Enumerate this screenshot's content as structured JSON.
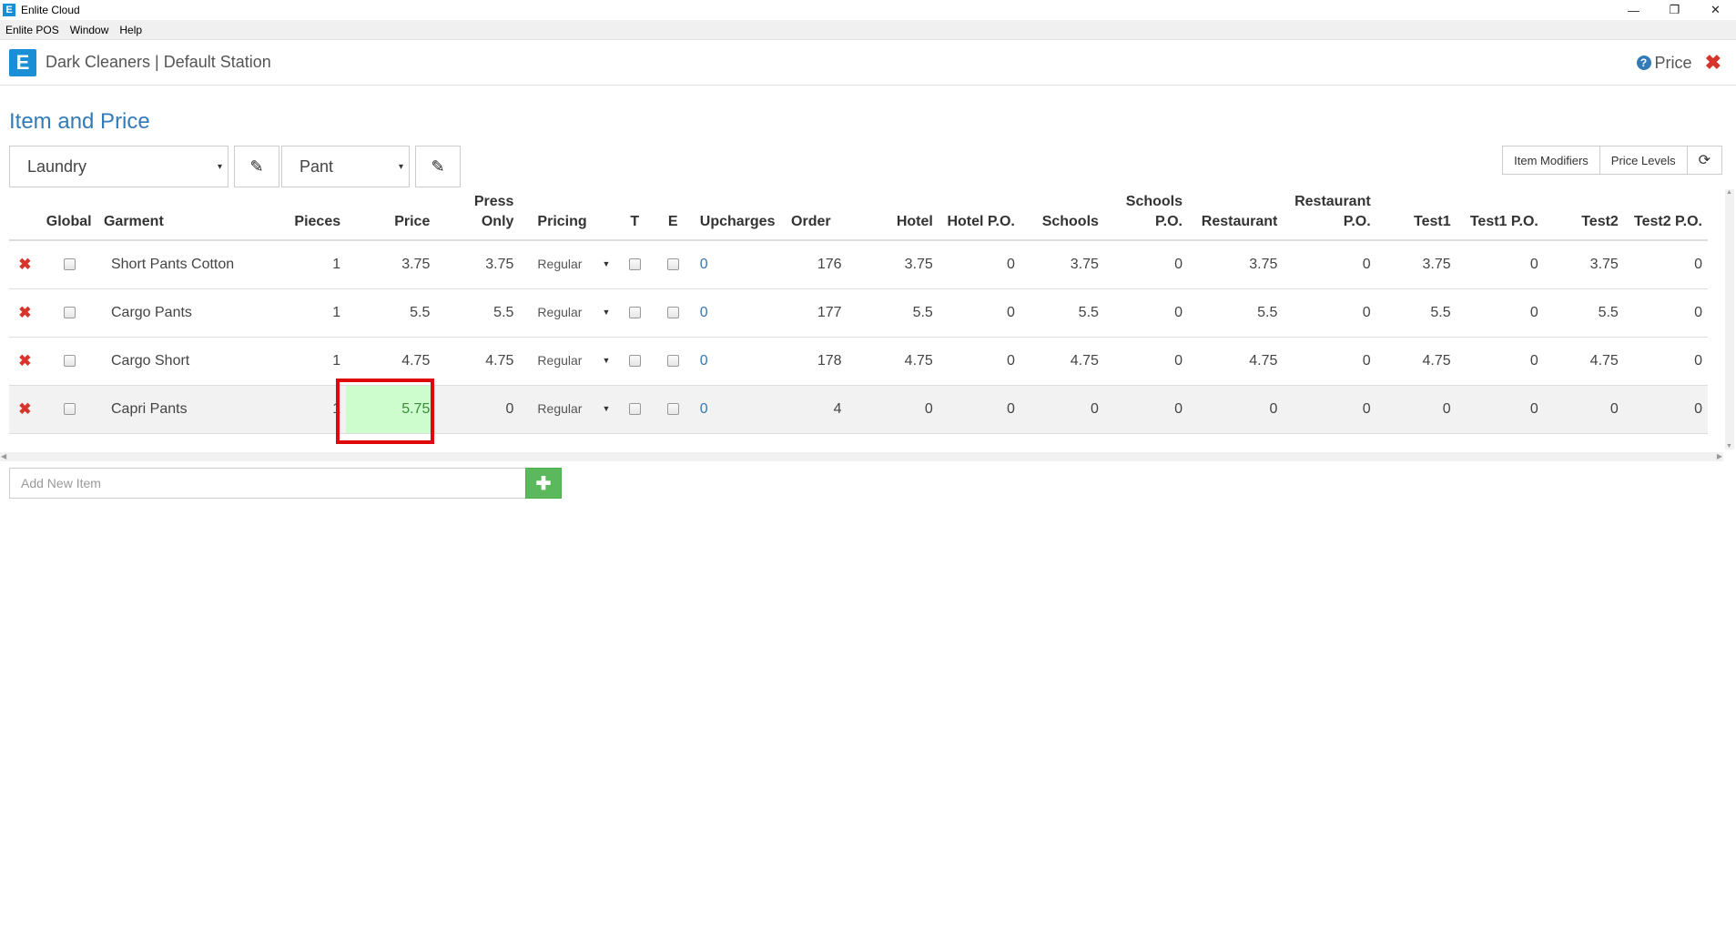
{
  "window": {
    "app_icon": "E",
    "title": "Enlite Cloud",
    "controls": {
      "minimize": "—",
      "restore": "❐",
      "close": "✕"
    }
  },
  "menu": {
    "items": [
      "Enlite POS",
      "Window",
      "Help"
    ]
  },
  "header": {
    "logo": "E",
    "title": "Dark Cleaners | Default Station",
    "help_icon": "?",
    "help_label": "Price",
    "close_icon": "✖"
  },
  "page": {
    "title": "Item and Price"
  },
  "toolbar": {
    "department": "Laundry",
    "category": "Pant",
    "caret": "▾",
    "edit_icon": "✎",
    "item_modifiers": "Item Modifiers",
    "price_levels": "Price Levels",
    "refresh_icon": "⟳"
  },
  "table": {
    "headers": {
      "global": "Global",
      "garment": "Garment",
      "pieces": "Pieces",
      "price": "Price",
      "press_only_1": "Press",
      "press_only_2": "Only",
      "pricing": "Pricing",
      "t": "T",
      "e": "E",
      "upcharges": "Upcharges",
      "order": "Order",
      "hotel": "Hotel",
      "hotel_po": "Hotel P.O.",
      "schools": "Schools",
      "schools_po_1": "Schools",
      "schools_po_2": "P.O.",
      "restaurant": "Restaurant",
      "restaurant_po_1": "Restaurant",
      "restaurant_po_2": "P.O.",
      "test1": "Test1",
      "test1_po": "Test1 P.O.",
      "test2": "Test2",
      "test2_po": "Test2 P.O."
    },
    "delete_icon": "✖",
    "pricing_caret": "▼",
    "rows": [
      {
        "garment": "Short Pants Cotton",
        "pieces": "1",
        "price": "3.75",
        "press_only": "3.75",
        "pricing": "Regular",
        "upcharges": "0",
        "order": "176",
        "hotel": "3.75",
        "hotel_po": "0",
        "schools": "3.75",
        "schools_po": "0",
        "restaurant": "3.75",
        "restaurant_po": "0",
        "test1": "3.75",
        "test1_po": "0",
        "test2": "3.75",
        "test2_po": "0"
      },
      {
        "garment": "Cargo Pants",
        "pieces": "1",
        "price": "5.5",
        "press_only": "5.5",
        "pricing": "Regular",
        "upcharges": "0",
        "order": "177",
        "hotel": "5.5",
        "hotel_po": "0",
        "schools": "5.5",
        "schools_po": "0",
        "restaurant": "5.5",
        "restaurant_po": "0",
        "test1": "5.5",
        "test1_po": "0",
        "test2": "5.5",
        "test2_po": "0"
      },
      {
        "garment": "Cargo Short",
        "pieces": "1",
        "price": "4.75",
        "press_only": "4.75",
        "pricing": "Regular",
        "upcharges": "0",
        "order": "178",
        "hotel": "4.75",
        "hotel_po": "0",
        "schools": "4.75",
        "schools_po": "0",
        "restaurant": "4.75",
        "restaurant_po": "0",
        "test1": "4.75",
        "test1_po": "0",
        "test2": "4.75",
        "test2_po": "0"
      },
      {
        "garment": "Capri Pants",
        "pieces": "1",
        "price": "5.75",
        "press_only": "0",
        "pricing": "Regular",
        "upcharges": "0",
        "order": "4",
        "hotel": "0",
        "hotel_po": "0",
        "schools": "0",
        "schools_po": "0",
        "restaurant": "0",
        "restaurant_po": "0",
        "test1": "0",
        "test1_po": "0",
        "test2": "0",
        "test2_po": "0"
      }
    ]
  },
  "scroll": {
    "up": "▲",
    "down": "▼",
    "left": "◀",
    "right": "▶"
  },
  "add_item": {
    "placeholder": "Add New Item",
    "button_icon": "✚"
  },
  "colors": {
    "brand": "#1a8fd6",
    "title_blue": "#337ab7",
    "delete_red": "#d9342b",
    "add_green": "#5cb85c",
    "edit_highlight": "#cdfccd",
    "focus_border": "#e0070b"
  }
}
